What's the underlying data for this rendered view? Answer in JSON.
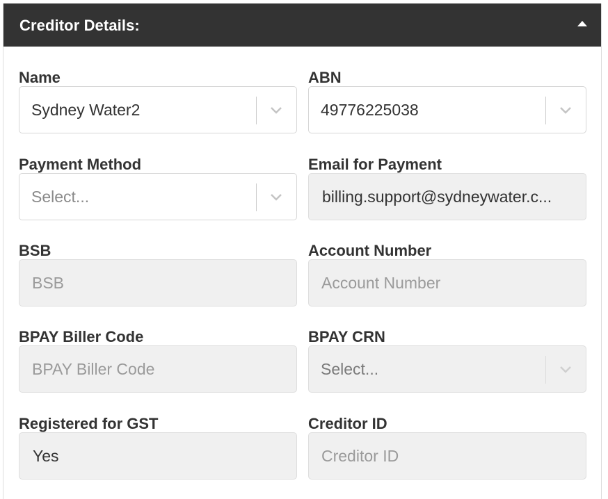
{
  "panel": {
    "title": "Creditor Details:"
  },
  "fields": {
    "name": {
      "label": "Name",
      "value": "Sydney Water2"
    },
    "abn": {
      "label": "ABN",
      "value": "49776225038"
    },
    "payment_method": {
      "label": "Payment Method",
      "placeholder": "Select..."
    },
    "email_for_payment": {
      "label": "Email for Payment",
      "value": "billing.support@sydneywater.c..."
    },
    "bsb": {
      "label": "BSB",
      "placeholder": "BSB"
    },
    "account_number": {
      "label": "Account Number",
      "placeholder": "Account Number"
    },
    "bpay_biller_code": {
      "label": "BPAY Biller Code",
      "placeholder": "BPAY Biller Code"
    },
    "bpay_crn": {
      "label": "BPAY CRN",
      "placeholder": "Select..."
    },
    "registered_for_gst": {
      "label": "Registered for GST",
      "value": "Yes"
    },
    "creditor_id": {
      "label": "Creditor ID",
      "placeholder": "Creditor ID"
    }
  },
  "icons": {
    "collapse": "caret-up-icon",
    "dropdown": "chevron-down-icon"
  },
  "colors": {
    "header_bg": "#333333",
    "disabled_bg": "#f0f0f0",
    "border": "#d6d6d6"
  }
}
